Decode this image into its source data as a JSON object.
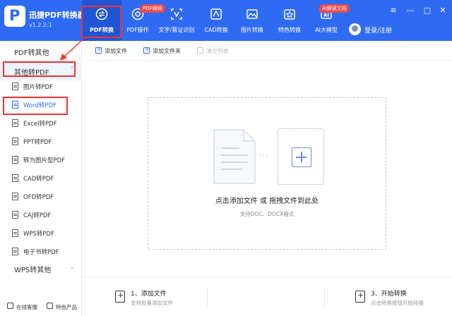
{
  "app": {
    "title": "迅捷PDF转换器",
    "version": "v1.2.2.1",
    "logo_letter": "P"
  },
  "nav": [
    {
      "label": "PDF转换",
      "icon": "convert-icon",
      "active": true
    },
    {
      "label": "PDF操作",
      "icon": "pdf-operate-icon",
      "badge": "PDF编辑"
    },
    {
      "label": "文字/票证识别",
      "icon": "ocr-icon"
    },
    {
      "label": "CAD转换",
      "icon": "cad-icon"
    },
    {
      "label": "图片转换",
      "icon": "image-icon"
    },
    {
      "label": "特色转换",
      "icon": "special-icon"
    },
    {
      "label": "AI大模型",
      "icon": "ai-icon",
      "badge": "AI解读文档"
    }
  ],
  "login": {
    "label": "登录/注册"
  },
  "window_controls": {
    "menu": "≡",
    "minimize": "—",
    "maximize": "□",
    "close": "✕"
  },
  "sidebar": {
    "groups": [
      {
        "label": "PDF转其他",
        "chevron": "⌄"
      },
      {
        "label": "其他转PDF",
        "chevron": "⌃"
      },
      {
        "label": "WPS转其他",
        "chevron": "⌄"
      }
    ],
    "items": [
      {
        "label": "图片转PDF"
      },
      {
        "label": "Word转PDF",
        "active": true
      },
      {
        "label": "Excel转PDF"
      },
      {
        "label": "PPT转PDF"
      },
      {
        "label": "转为图片型PDF"
      },
      {
        "label": "CAD转PDF"
      },
      {
        "label": "OFD转PDF"
      },
      {
        "label": "CAJ转PDF"
      },
      {
        "label": "WPS转PDF"
      },
      {
        "label": "电子书转PDF"
      }
    ],
    "footer": [
      {
        "label": "在线客服",
        "icon": "service-icon"
      },
      {
        "label": "特色产品",
        "icon": "products-icon"
      }
    ]
  },
  "toolbar": {
    "add_file": "添加文件",
    "add_folder": "添加文件夹",
    "clear_list": "清空列表"
  },
  "dropzone": {
    "arrows": "›››",
    "main_text": "点击添加文件 或 拖拽文件到此处",
    "sub_text": "支持DOC、DOCX格式"
  },
  "steps": [
    {
      "title": "1、添加文件",
      "sub": "支持批量添加文件"
    },
    {
      "title": "3、开始转换",
      "sub": "点击转换按钮开始转换"
    }
  ],
  "colors": {
    "brand": "#2f6bf2",
    "nav_active": "#1f55d6",
    "badge": "#f04848",
    "annotation_red": "#e33333"
  }
}
